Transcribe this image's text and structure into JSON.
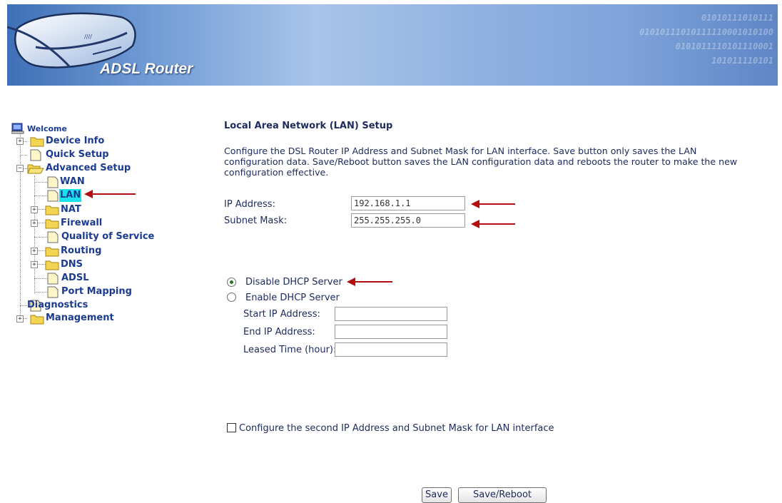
{
  "banner": {
    "logo_text": "ADSL Router",
    "binary_lines": [
      "01010111010111",
      "01010111010111110001010100",
      "0101011110101110001",
      "101011110101"
    ]
  },
  "sidebar": {
    "welcome": "Welcome",
    "items": [
      {
        "label": "Device Info"
      },
      {
        "label": "Quick Setup"
      },
      {
        "label": "Advanced Setup"
      },
      {
        "label": "WAN"
      },
      {
        "label": "LAN"
      },
      {
        "label": "NAT"
      },
      {
        "label": "Firewall"
      },
      {
        "label": "Quality of Service"
      },
      {
        "label": "Routing"
      },
      {
        "label": "DNS"
      },
      {
        "label": "ADSL"
      },
      {
        "label": "Port Mapping"
      },
      {
        "label": "Diagnostics"
      },
      {
        "label": "Management"
      }
    ],
    "selected": "LAN"
  },
  "main": {
    "title": "Local Area Network (LAN) Setup",
    "description": "Configure the DSL Router IP Address and Subnet Mask for LAN interface.  Save button only saves the LAN configuration data.  Save/Reboot button saves the LAN configuration data and reboots the router to make the new configuration effective.",
    "ip_label": "IP Address:",
    "ip_value": "192.168.1.1",
    "mask_label": "Subnet Mask:",
    "mask_value": "255.255.255.0",
    "dhcp_disable_label": "Disable DHCP Server",
    "dhcp_enable_label": "Enable DHCP Server",
    "dhcp_selected": "disable",
    "start_ip_label": "Start IP Address:",
    "start_ip_value": "",
    "end_ip_label": "End IP Address:",
    "end_ip_value": "",
    "lease_label": "Leased Time (hour):",
    "lease_value": "",
    "second_ip_label": "Configure the second IP Address and Subnet Mask for LAN interface",
    "second_ip_checked": false,
    "save_label": "Save",
    "save_reboot_label": "Save/Reboot"
  },
  "colors": {
    "annotation_arrow": "#b10f12",
    "lan_highlight": "#1be1ec",
    "tree_text": "#1b3b93"
  }
}
